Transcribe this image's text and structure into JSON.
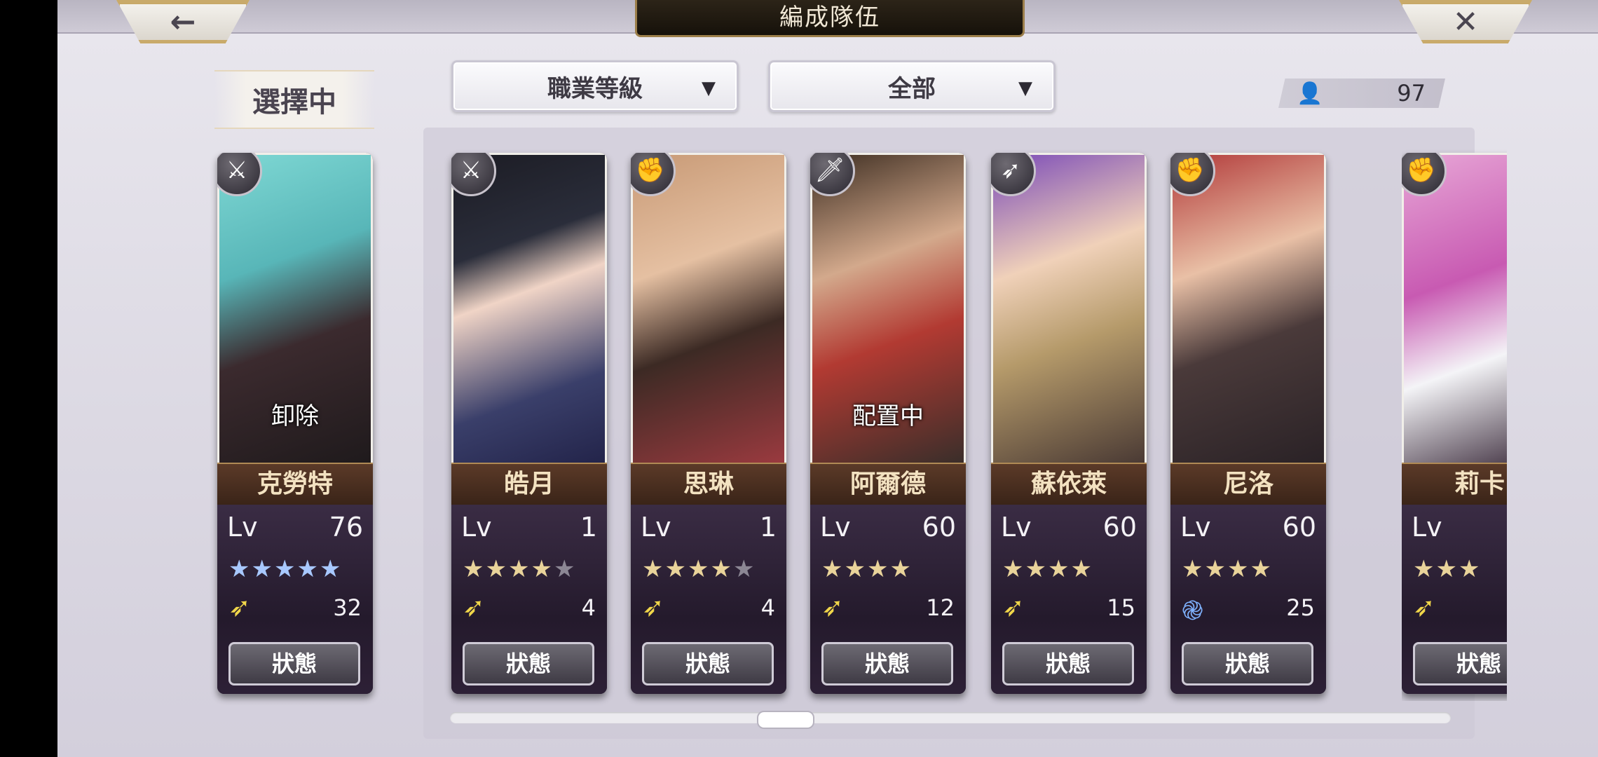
{
  "header": {
    "title": "編成隊伍",
    "back_icon": "←",
    "close_icon": "✕"
  },
  "selected_label": "選擇中",
  "filters": {
    "job_level": "職業等級",
    "scope": "全部",
    "caret": "▼"
  },
  "unit_count": {
    "icon": "👤",
    "value": "97"
  },
  "status_label": "狀態",
  "cards": [
    {
      "name": "克勞特",
      "lv_label": "Lv",
      "lv": "76",
      "stars": 5,
      "star_color": "blue",
      "max_stars": 5,
      "ticket": "swirl-none",
      "points": "32",
      "overlay": "卸除",
      "class_icon": "⚔"
    },
    {
      "name": "皓月",
      "lv_label": "Lv",
      "lv": "1",
      "stars": 4,
      "max_stars": 5,
      "points": "4",
      "overlay": "",
      "class_icon": "⚔"
    },
    {
      "name": "思琳",
      "lv_label": "Lv",
      "lv": "1",
      "stars": 4,
      "max_stars": 5,
      "points": "4",
      "overlay": "",
      "class_icon": "✊"
    },
    {
      "name": "阿爾德",
      "lv_label": "Lv",
      "lv": "60",
      "stars": 4,
      "max_stars": 4,
      "points": "12",
      "overlay": "配置中",
      "class_icon": "🗡"
    },
    {
      "name": "蘇依萊",
      "lv_label": "Lv",
      "lv": "60",
      "stars": 4,
      "max_stars": 4,
      "points": "15",
      "overlay": "",
      "class_icon": "➶"
    },
    {
      "name": "尼洛",
      "lv_label": "Lv",
      "lv": "60",
      "stars": 4,
      "max_stars": 4,
      "points": "25",
      "overlay": "",
      "class_icon": "✊"
    },
    {
      "name": "莉卡",
      "lv_label": "Lv",
      "lv": "",
      "stars": 3,
      "max_stars": 3,
      "points": "",
      "overlay": "",
      "class_icon": "✊"
    }
  ],
  "colors": {
    "name_bar": "#4a2e20",
    "star_gold": "#e9d39a",
    "star_blue": "#a8c8ff",
    "ticket_gold": "#f0d64a"
  }
}
